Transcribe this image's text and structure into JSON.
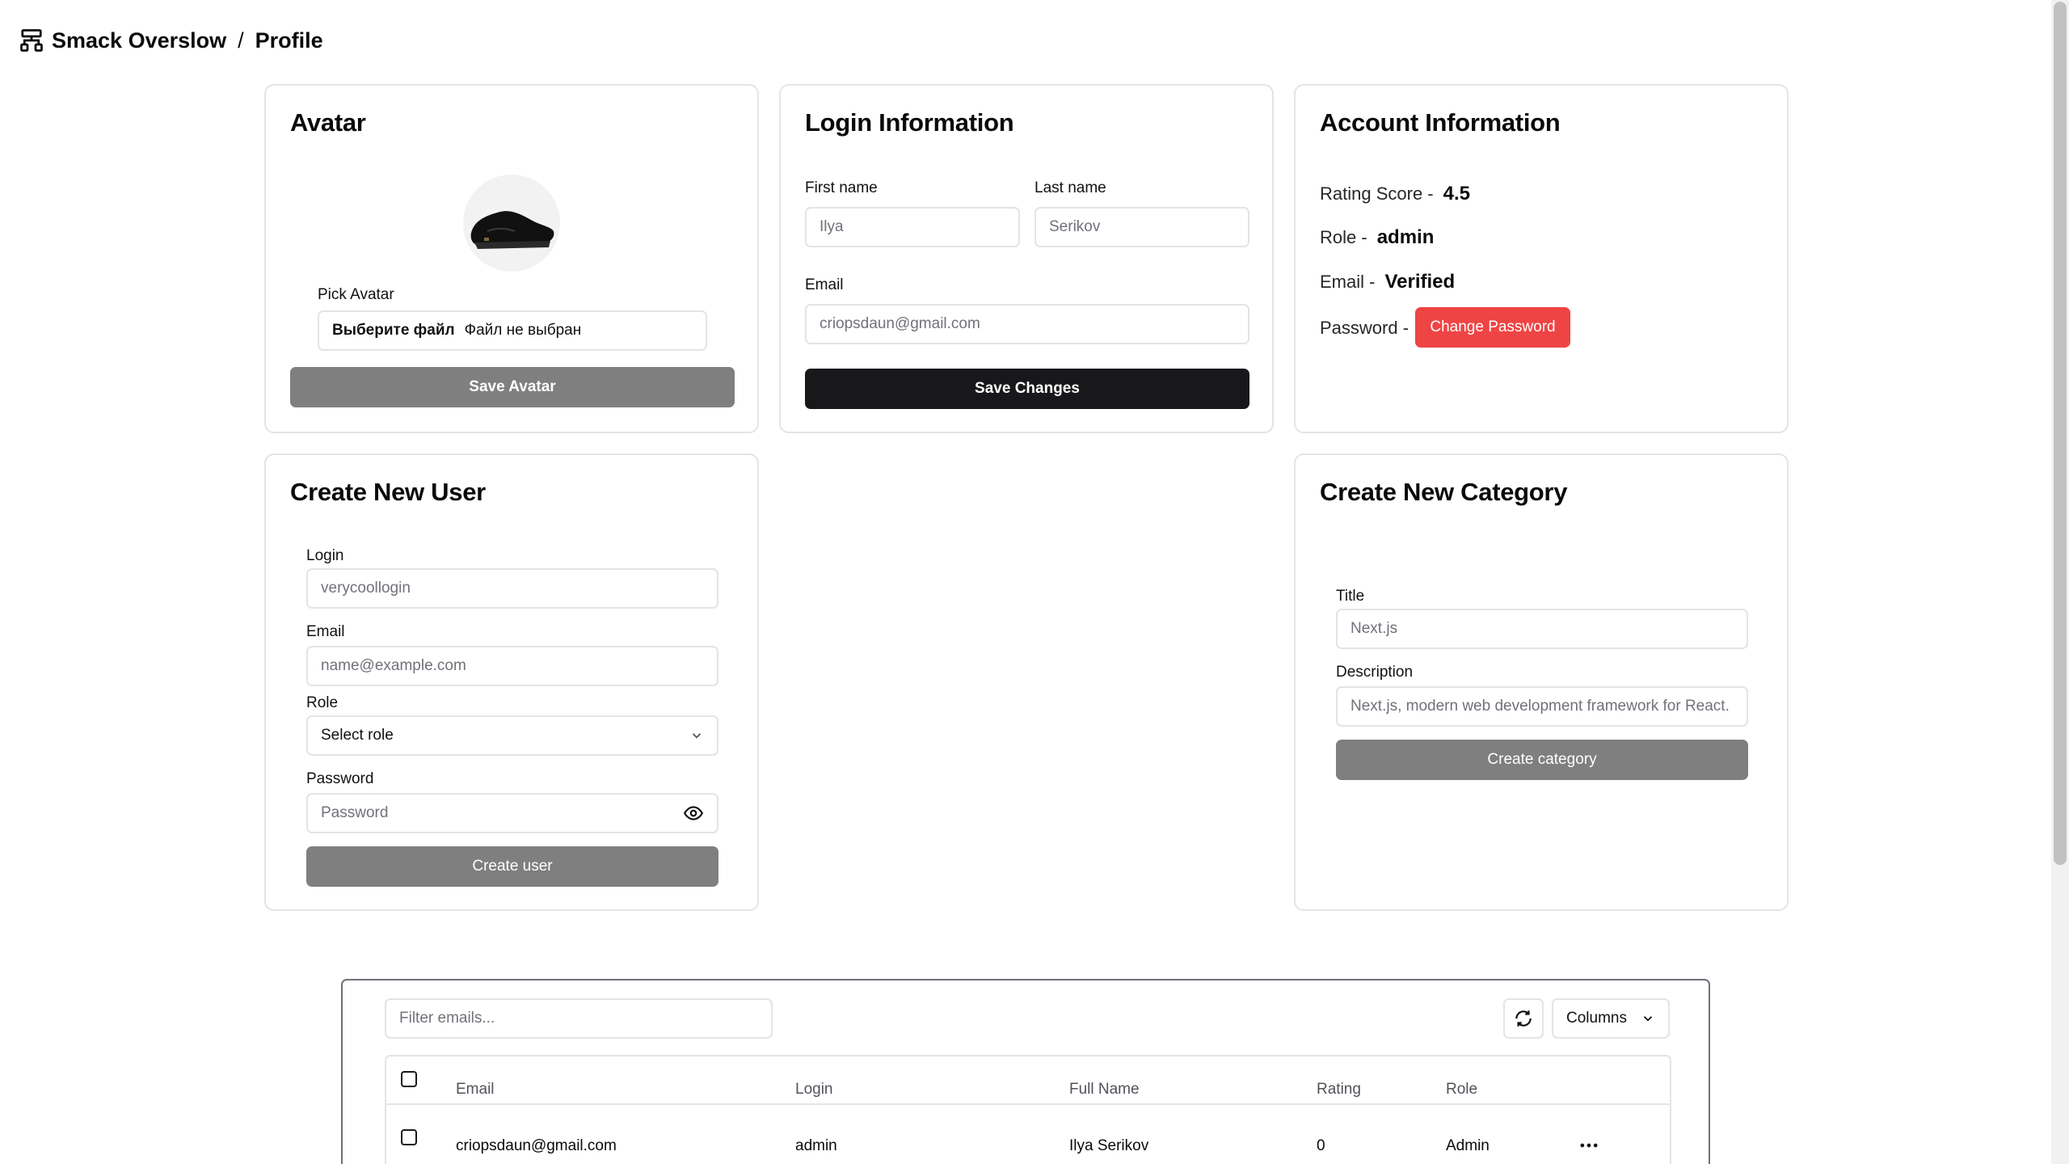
{
  "header": {
    "app_name": "Smack Overslow",
    "separator": "/",
    "page": "Profile"
  },
  "avatar_card": {
    "title": "Avatar",
    "pick_label": "Pick Avatar",
    "file_button": "Выберите файл",
    "file_status": "Файл не выбран",
    "save_button": "Save Avatar"
  },
  "login_card": {
    "title": "Login Information",
    "first_name_label": "First name",
    "first_name_value": "Ilya",
    "last_name_label": "Last name",
    "last_name_value": "Serikov",
    "email_label": "Email",
    "email_value": "criopsdaun@gmail.com",
    "save_button": "Save Changes"
  },
  "account_card": {
    "title": "Account Information",
    "rating_label": "Rating Score -",
    "rating_value": "4.5",
    "role_label": "Role -",
    "role_value": "admin",
    "email_label": "Email -",
    "email_value": "Verified",
    "password_label": "Password -",
    "change_password_button": "Change Password"
  },
  "create_user_card": {
    "title": "Create New User",
    "login_label": "Login",
    "login_placeholder": "verycoollogin",
    "email_label": "Email",
    "email_placeholder": "name@example.com",
    "role_label": "Role",
    "role_placeholder": "Select role",
    "password_label": "Password",
    "password_placeholder": "Password",
    "create_button": "Create user"
  },
  "create_category_card": {
    "title": "Create New Category",
    "title_label": "Title",
    "title_placeholder": "Next.js",
    "description_label": "Description",
    "description_placeholder": "Next.js, modern web development framework for React.",
    "create_button": "Create category"
  },
  "users_table": {
    "filter_placeholder": "Filter emails...",
    "columns_button": "Columns",
    "headers": [
      "Email",
      "Login",
      "Full Name",
      "Rating",
      "Role"
    ],
    "rows": [
      {
        "email": "criopsdaun@gmail.com",
        "login": "admin",
        "full_name": "Ilya Serikov",
        "rating": "0",
        "role": "Admin"
      }
    ]
  },
  "colors": {
    "accent_red": "#ef4444",
    "button_black": "#18181b",
    "button_gray": "#7f7f7f",
    "border": "#e4e4e7"
  }
}
